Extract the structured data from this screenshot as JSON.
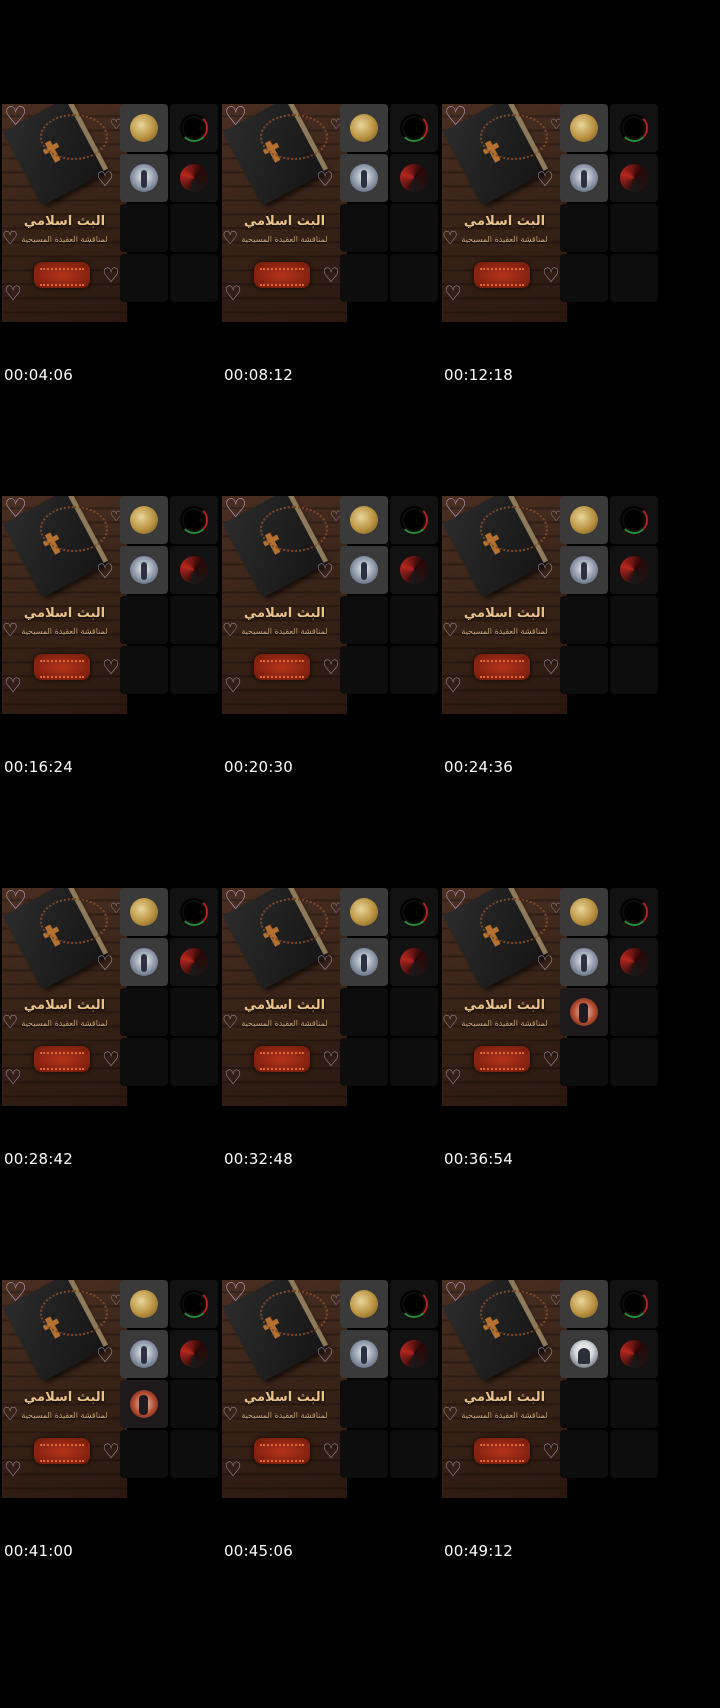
{
  "poster": {
    "title": "البث اسلامي",
    "subtitle": "لمناقشة العقيدة المسيحية"
  },
  "frames": [
    {
      "timestamp": "00:04:06",
      "tiles": [
        "gold-avatar",
        "ring-avatar",
        "man-avatar",
        "red-avatar",
        "empty",
        "empty",
        "empty",
        "empty"
      ]
    },
    {
      "timestamp": "00:08:12",
      "tiles": [
        "gold-avatar",
        "ring-avatar",
        "man-avatar",
        "red-avatar",
        "empty",
        "empty",
        "empty",
        "empty"
      ]
    },
    {
      "timestamp": "00:12:18",
      "tiles": [
        "gold-avatar",
        "ring-avatar",
        "man-avatar",
        "red-avatar",
        "empty",
        "empty",
        "empty",
        "empty"
      ]
    },
    {
      "timestamp": "00:16:24",
      "tiles": [
        "gold-avatar",
        "ring-avatar",
        "man-avatar",
        "red-avatar",
        "empty",
        "empty",
        "empty",
        "empty"
      ]
    },
    {
      "timestamp": "00:20:30",
      "tiles": [
        "gold-avatar",
        "ring-avatar",
        "man-avatar",
        "red-avatar",
        "empty",
        "empty",
        "empty",
        "empty"
      ]
    },
    {
      "timestamp": "00:24:36",
      "tiles": [
        "gold-avatar",
        "ring-avatar",
        "man-avatar",
        "red-avatar",
        "empty",
        "empty",
        "empty",
        "empty"
      ]
    },
    {
      "timestamp": "00:28:42",
      "tiles": [
        "gold-avatar",
        "ring-avatar",
        "man-avatar",
        "red-avatar",
        "empty",
        "empty",
        "empty",
        "empty"
      ]
    },
    {
      "timestamp": "00:32:48",
      "tiles": [
        "gold-avatar",
        "ring-avatar",
        "man-avatar",
        "red-avatar",
        "empty",
        "empty",
        "empty",
        "empty"
      ]
    },
    {
      "timestamp": "00:36:54",
      "tiles": [
        "gold-avatar",
        "ring-avatar",
        "man-avatar",
        "red-avatar",
        "woman-avatar",
        "empty",
        "empty",
        "empty"
      ]
    },
    {
      "timestamp": "00:41:00",
      "tiles": [
        "gold-avatar",
        "ring-avatar",
        "man-avatar",
        "red-avatar",
        "woman-avatar",
        "empty",
        "empty",
        "empty"
      ]
    },
    {
      "timestamp": "00:45:06",
      "tiles": [
        "gold-avatar",
        "ring-avatar",
        "man-avatar",
        "red-avatar",
        "empty",
        "empty",
        "empty",
        "empty"
      ]
    },
    {
      "timestamp": "00:49:12",
      "tiles": [
        "gold-avatar",
        "ring-avatar",
        "hooded-avatar",
        "red-avatar",
        "empty",
        "empty",
        "empty",
        "empty"
      ]
    }
  ],
  "colors": {
    "background": "#000000",
    "timestamp_text": "#ffffff",
    "poster_title": "#e8c48a",
    "tile_active": "#3a3a3a",
    "tile_empty": "#111111"
  }
}
